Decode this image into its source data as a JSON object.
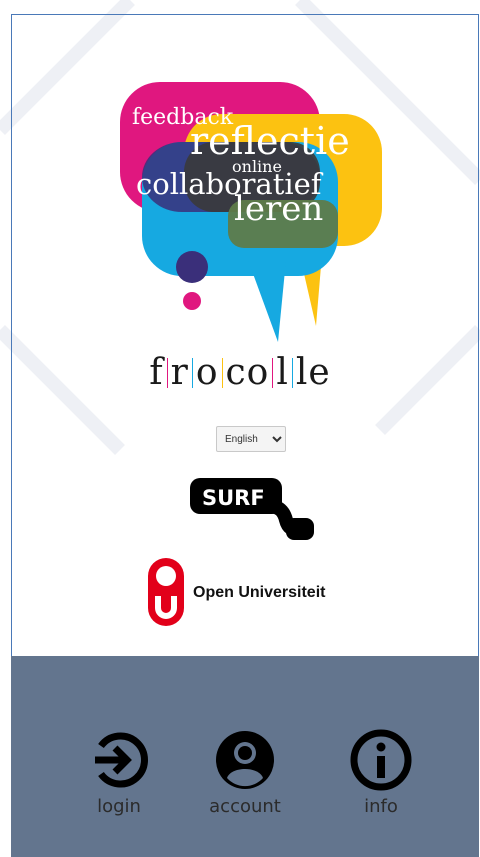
{
  "logo": {
    "words": [
      "feedback",
      "reflectie",
      "online",
      "collaboratief",
      "leren"
    ],
    "colors": {
      "magenta": "#e0177f",
      "yellow": "#fcc211",
      "cyan": "#16a9e1",
      "dark": "#2b2b2b"
    }
  },
  "brand": {
    "letters": [
      "f",
      "r",
      "o",
      "co",
      "l",
      "le"
    ],
    "bar_colors": [
      "#e0177f",
      "#16a9e1",
      "#fcc211",
      "#e0177f",
      "#16a9e1"
    ]
  },
  "language": {
    "selected": "English",
    "options": [
      "English"
    ]
  },
  "surf": {
    "text": "SURF"
  },
  "ou": {
    "text": "Open Universiteit",
    "color": "#e2001a"
  },
  "nav": {
    "login": {
      "label": "login",
      "icon": "login-icon"
    },
    "account": {
      "label": "account",
      "icon": "account-icon"
    },
    "info": {
      "label": "info",
      "icon": "info-icon"
    }
  },
  "colors": {
    "bottom_bar": "#63758e",
    "frame": "#4a79b8"
  }
}
